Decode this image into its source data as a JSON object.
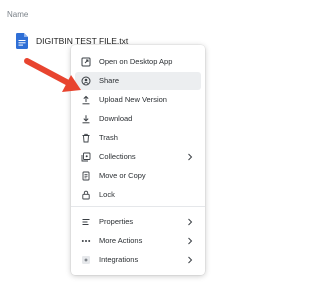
{
  "header": {
    "name_col": "Name"
  },
  "file": {
    "name": "DIGITBIN TEST FILE.txt",
    "icon": "document-icon",
    "icon_color": "#2f6fd6"
  },
  "menu": {
    "highlighted": "Share",
    "items": [
      {
        "label": "Open on Desktop App",
        "icon": "open-external-icon"
      },
      {
        "label": "Share",
        "icon": "share-icon"
      },
      {
        "label": "Upload New Version",
        "icon": "upload-icon"
      },
      {
        "label": "Download",
        "icon": "download-icon"
      },
      {
        "label": "Trash",
        "icon": "trash-icon"
      },
      {
        "label": "Collections",
        "icon": "collections-icon",
        "submenu": true
      },
      {
        "label": "Move or Copy",
        "icon": "move-copy-icon"
      },
      {
        "label": "Lock",
        "icon": "lock-icon"
      },
      {
        "label": "Properties",
        "icon": "properties-icon",
        "submenu": true
      },
      {
        "label": "More Actions",
        "icon": "more-actions-icon",
        "submenu": true
      },
      {
        "label": "Integrations",
        "icon": "integrations-icon",
        "submenu": true
      }
    ]
  },
  "annotation": {
    "arrow_color": "#e8442f",
    "arrow_icon": "pointer-arrow-icon"
  }
}
